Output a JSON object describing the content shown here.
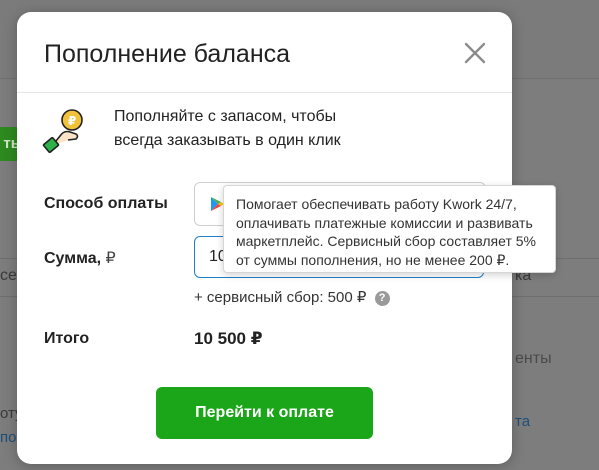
{
  "background": {
    "green_button_text": "ть",
    "left_text": "се",
    "right_text": "ка",
    "right_text2": "енты",
    "left_small1": "оту",
    "left_small2": "по",
    "right_link": "та"
  },
  "modal": {
    "title": "Пополнение баланса",
    "close_icon": "close-icon",
    "promo": {
      "icon": "hand-coin-icon",
      "line1": "Пополняйте с запасом, чтобы",
      "line2": "всегда заказывать в один клик"
    },
    "payment_method": {
      "label": "Способ оплаты",
      "icon": "google-play-icon"
    },
    "amount": {
      "label": "Сумма,",
      "currency": "₽",
      "value": "10 000"
    },
    "fee": {
      "text": "+ сервисный сбор: 500 ₽",
      "help_glyph": "?"
    },
    "total": {
      "label": "Итого",
      "value": "10 500 ₽"
    },
    "pay_button": "Перейти к оплате"
  },
  "tooltip": {
    "line1": "Помогает обеспечивать работу Kwork 24/7,",
    "line2": "оплачивать платежные комиссии и развивать",
    "line3": "маркетплейс. Сервисный сбор составляет 5%",
    "line4": "от суммы пополнения, но не менее 200 ₽."
  },
  "colors": {
    "accent_green": "#1ba518",
    "focus_blue": "#1f7fc9",
    "overlay": "#7d7d7d"
  }
}
